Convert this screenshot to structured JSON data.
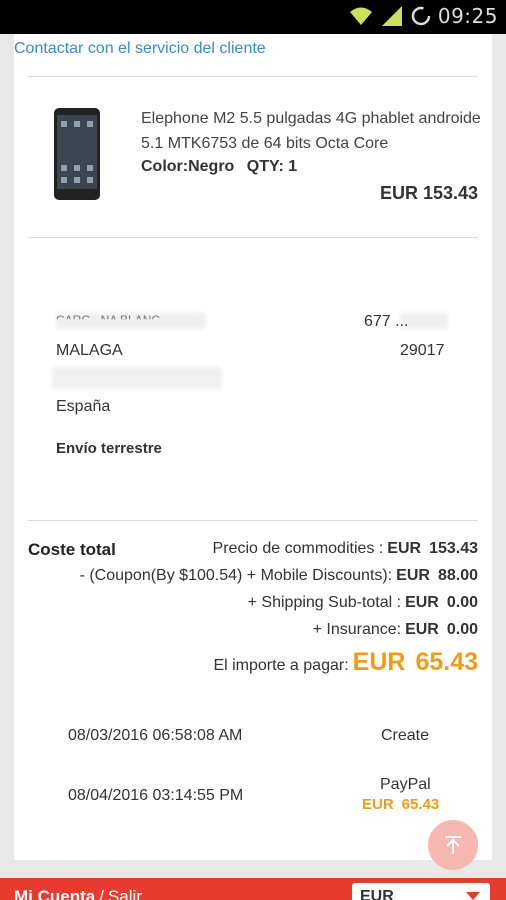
{
  "status_bar": {
    "time": "09:25"
  },
  "contact_link": "Contactar con el servicio del cliente",
  "product": {
    "title": "Elephone M2 5.5 pulgadas 4G phablet androide 5.1 MTK6753 de 64 bits Octa Core",
    "color": "Color:Negro",
    "qty": "QTY: 1",
    "price": "EUR 153.43"
  },
  "address": {
    "name_fragment": "CARG...NA BLANC...",
    "phone_fragment": "677 ...",
    "city": "MALAGA",
    "postal_code": "29017",
    "country": "España"
  },
  "shipping_method": "Envío terrestre",
  "totals": {
    "label": "Coste total",
    "rows": [
      {
        "key": "Precio de commodities :",
        "currency": "EUR",
        "value": "153.43"
      },
      {
        "key": "- (Coupon(By $100.54) + Mobile Discounts):",
        "currency": "EUR",
        "value": "88.00"
      },
      {
        "key": "+ Shipping Sub-total :",
        "currency": "EUR",
        "value": "0.00"
      },
      {
        "key": "+ Insurance:",
        "currency": "EUR",
        "value": "0.00"
      }
    ],
    "payable": {
      "key": "El importe a pagar:",
      "currency": "EUR",
      "value": "65.43"
    }
  },
  "order_log": [
    {
      "date": "08/03/2016 06:58:08 AM",
      "status": "Create"
    },
    {
      "date": "08/04/2016 03:14:55 PM",
      "status": "PayPal",
      "currency": "EUR",
      "amount": "65.43"
    }
  ],
  "bottom_bar": {
    "account": "Mi Cuenta",
    "separator": "/",
    "exit": "Salir",
    "currency_selected": "EUR"
  },
  "colors": {
    "accent_red": "#e63b2e",
    "link_blue": "#3a8ad6",
    "price_orange": "#f39c12"
  },
  "icons": [
    "wifi-icon",
    "signal-icon",
    "sync-icon",
    "back-to-top-icon",
    "chevron-down-icon"
  ]
}
